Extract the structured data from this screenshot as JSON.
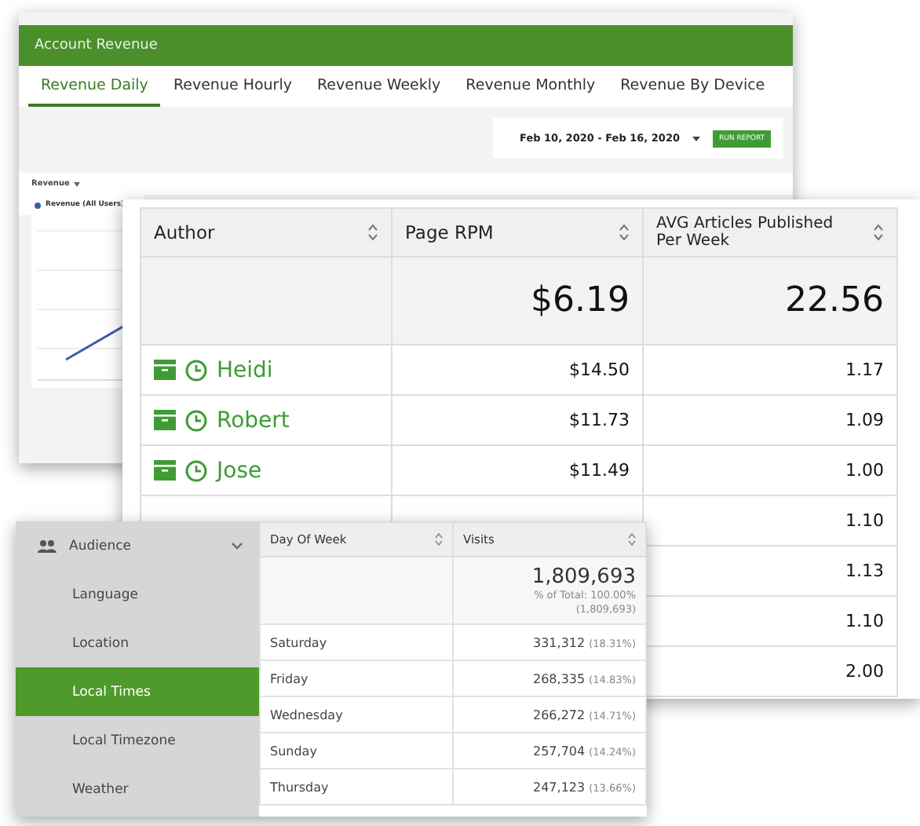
{
  "revenue_window": {
    "title": "Account Revenue",
    "tabs": [
      {
        "label": "Revenue Daily",
        "selected": true
      },
      {
        "label": "Revenue Hourly",
        "selected": false
      },
      {
        "label": "Revenue Weekly",
        "selected": false
      },
      {
        "label": "Revenue Monthly",
        "selected": false
      },
      {
        "label": "Revenue By Device",
        "selected": false
      }
    ],
    "date_range": "Feb 10, 2020 - Feb 16, 2020",
    "run_button": "RUN REPORT",
    "metric_select": "Revenue",
    "legend": "Revenue (All Users)"
  },
  "author_table": {
    "columns": [
      "Author",
      "Page RPM",
      "AVG Articles Published Per Week"
    ],
    "totals": {
      "rpm": "$6.19",
      "avg": "22.56"
    },
    "rows": [
      {
        "author": "Heidi",
        "rpm": "$14.50",
        "avg": "1.17"
      },
      {
        "author": "Robert",
        "rpm": "$11.73",
        "avg": "1.09"
      },
      {
        "author": "Jose",
        "rpm": "$11.49",
        "avg": "1.00"
      },
      {
        "avg": "1.10"
      },
      {
        "avg": "1.13"
      },
      {
        "avg": "1.10"
      },
      {
        "avg": "2.00"
      }
    ]
  },
  "audience_panel": {
    "sidebar": [
      {
        "label": "Audience",
        "kind": "group",
        "selected": false
      },
      {
        "label": "Language",
        "kind": "item",
        "selected": false
      },
      {
        "label": "Location",
        "kind": "item",
        "selected": false
      },
      {
        "label": "Local Times",
        "kind": "item",
        "selected": true
      },
      {
        "label": "Local Timezone",
        "kind": "item",
        "selected": false
      },
      {
        "label": "Weather",
        "kind": "item",
        "selected": false
      }
    ],
    "columns": [
      "Day Of Week",
      "Visits"
    ],
    "total": {
      "value": "1,809,693",
      "share": "% of Total: 100.00% (1,809,693)"
    },
    "rows": [
      {
        "day": "Saturday",
        "visits": "331,312",
        "pct": "(18.31%)"
      },
      {
        "day": "Friday",
        "visits": "268,335",
        "pct": "(14.83%)"
      },
      {
        "day": "Wednesday",
        "visits": "266,272",
        "pct": "(14.71%)"
      },
      {
        "day": "Sunday",
        "visits": "257,704",
        "pct": "(14.24%)"
      },
      {
        "day": "Thursday",
        "visits": "247,123",
        "pct": "(13.66%)"
      }
    ]
  }
}
